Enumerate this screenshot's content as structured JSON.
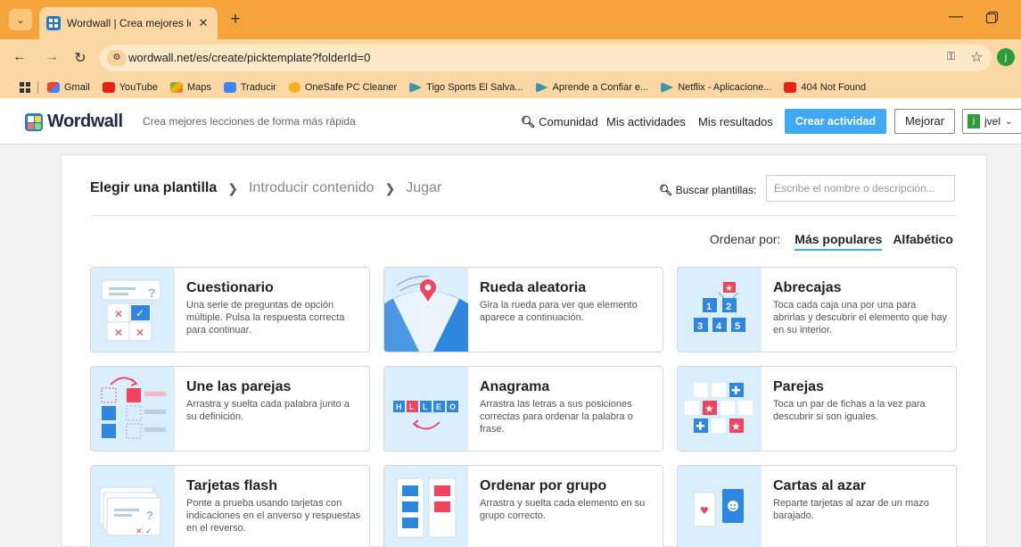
{
  "browser": {
    "tab_title": "Wordwall | Crea mejores leccion",
    "url": "wordwall.net/es/create/picktemplate?folderId=0",
    "profile_initial": "j",
    "bookmarks": [
      "Gmail",
      "YouTube",
      "Maps",
      "Traducir",
      "OneSafe PC Cleaner",
      "Tigo Sports El Salva...",
      "Aprende a Confiar e...",
      "Netflix - Aplicacione...",
      "404 Not Found"
    ]
  },
  "header": {
    "logo": "Wordwall",
    "tagline": "Crea mejores lecciones de forma más rápida",
    "nav": {
      "community": "Comunidad",
      "my_activities": "Mis actividades",
      "my_results": "Mis resultados"
    },
    "create_button": "Crear actividad",
    "upgrade_button": "Mejorar",
    "user_initial": "j",
    "user_name": "jvel"
  },
  "steps": [
    "Elegir una plantilla",
    "Introducir contenido",
    "Jugar"
  ],
  "search": {
    "label": "Buscar plantillas:",
    "placeholder": "Escribe el nombre o descripción..."
  },
  "sort": {
    "label": "Ordenar por:",
    "options": [
      "Más populares",
      "Alfabético"
    ],
    "active": "Más populares"
  },
  "templates": [
    {
      "name": "Cuestionario",
      "desc": "Una serie de preguntas de opción múltiple. Pulsa la respuesta correcta para continuar."
    },
    {
      "name": "Rueda aleatoria",
      "desc": "Gira la rueda para ver que elemento aparece a continuación."
    },
    {
      "name": "Abrecajas",
      "desc": "Toca cada caja una por una para abrirlas y descubrir el elemento que hay en su interior."
    },
    {
      "name": "Une las parejas",
      "desc": "Arrastra y suelta cada palabra junto a su definición."
    },
    {
      "name": "Anagrama",
      "desc": "Arrastra las letras a sus posiciones correctas para ordenar la palabra o frase."
    },
    {
      "name": "Parejas",
      "desc": "Toca un par de fichas a la vez para descubrir si son iguales."
    },
    {
      "name": "Tarjetas flash",
      "desc": "Ponte a prueba usando tarjetas con indicaciones en el anverso y respuestas en el reverso."
    },
    {
      "name": "Ordenar por grupo",
      "desc": "Arrastra y suelta cada elemento en su grupo correcto."
    },
    {
      "name": "Cartas al azar",
      "desc": "Reparte tarjetas al azar de un mazo barajado."
    }
  ],
  "thumb_text": {
    "abrecajas_numbers": [
      "1",
      "2",
      "3",
      "4",
      "5"
    ],
    "anagrama_letters": [
      "H",
      "L",
      "L",
      "E",
      "O"
    ]
  },
  "colors": {
    "chrome": "#f5a43c",
    "accent": "#3fa9f5",
    "brand": "#2a79c9",
    "tile_red": "#f0445e",
    "thumb_bg": "#dbeefc"
  }
}
